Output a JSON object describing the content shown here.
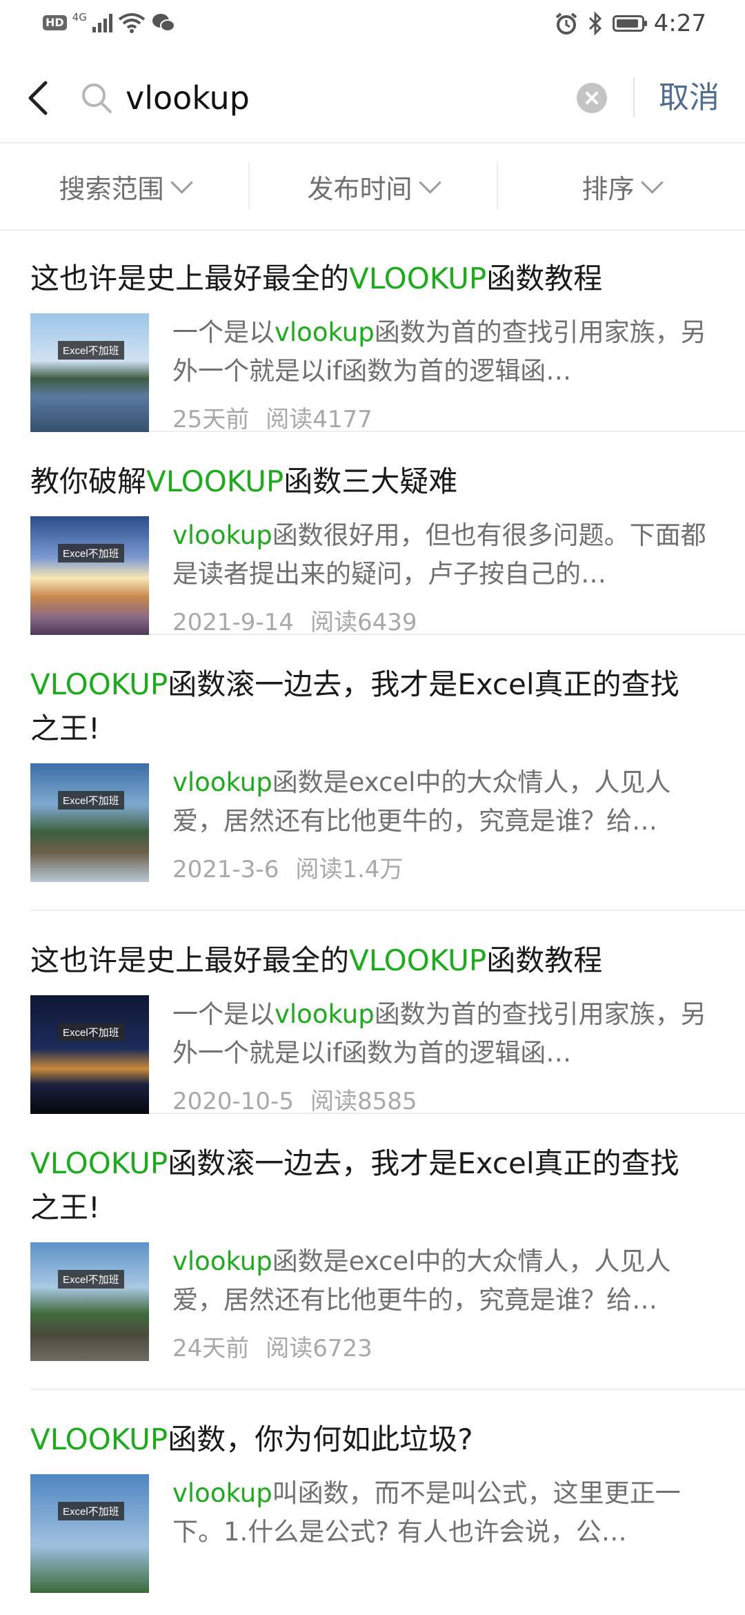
{
  "status_bar": {
    "left_badge": "HD",
    "network": "4G",
    "time": "4:27",
    "icons": [
      "hd-icon",
      "signal-icon",
      "wifi-icon",
      "wechat-icon",
      "alarm-icon",
      "bluetooth-icon",
      "battery-icon"
    ]
  },
  "search": {
    "query": "vlookup",
    "cancel_label": "取消"
  },
  "filters": [
    {
      "label": "搜索范围"
    },
    {
      "label": "发布时间"
    },
    {
      "label": "排序"
    }
  ],
  "results": [
    {
      "title_pre": "这也许是史上最好最全的",
      "title_hl": "VLOOKUP",
      "title_post": "函数教程",
      "summary_pre": "一个是以",
      "summary_hl": "vlookup",
      "summary_post": "函数为首的查找引用家族，另外一个就是以if函数为首的逻辑函…",
      "date": "25天前",
      "reads": "阅读4177",
      "thumb_tag": "Excel不加班"
    },
    {
      "title_pre": "教你破解",
      "title_hl": "VLOOKUP",
      "title_post": "函数三大疑难",
      "summary_pre": "",
      "summary_hl": "vlookup",
      "summary_post": "函数很好用，但也有很多问题。下面都是读者提出来的疑问，卢子按自己的…",
      "date": "2021-9-14",
      "reads": "阅读6439",
      "thumb_tag": "Excel不加班"
    },
    {
      "title_pre": "",
      "title_hl": "VLOOKUP",
      "title_post": "函数滚一边去，我才是Excel真正的查找之王!",
      "summary_pre": "",
      "summary_hl": "vlookup",
      "summary_post": "函数是excel中的大众情人，人见人爱，居然还有比他更牛的，究竟是谁？给…",
      "date": "2021-3-6",
      "reads": "阅读1.4万",
      "thumb_tag": "Excel不加班"
    },
    {
      "title_pre": "这也许是史上最好最全的",
      "title_hl": "VLOOKUP",
      "title_post": "函数教程",
      "summary_pre": "一个是以",
      "summary_hl": "vlookup",
      "summary_post": "函数为首的查找引用家族，另外一个就是以if函数为首的逻辑函…",
      "date": "2020-10-5",
      "reads": "阅读8585",
      "thumb_tag": "Excel不加班"
    },
    {
      "title_pre": "",
      "title_hl": "VLOOKUP",
      "title_post": "函数滚一边去，我才是Excel真正的查找之王!",
      "summary_pre": "",
      "summary_hl": "vlookup",
      "summary_post": "函数是excel中的大众情人，人见人爱，居然还有比他更牛的，究竟是谁？给…",
      "date": "24天前",
      "reads": "阅读6723",
      "thumb_tag": "Excel不加班"
    },
    {
      "title_pre": "",
      "title_hl": "VLOOKUP",
      "title_post": "函数，你为何如此垃圾?",
      "summary_pre": "",
      "summary_hl": "vlookup",
      "summary_post": "叫函数，而不是叫公式，这里更正一下。1.什么是公式? 有人也许会说，公…",
      "date": "",
      "reads": "",
      "thumb_tag": "Excel不加班"
    }
  ],
  "colors": {
    "highlight": "#1aad19",
    "cancel": "#4f6d93",
    "meta": "#a8a8a8"
  }
}
